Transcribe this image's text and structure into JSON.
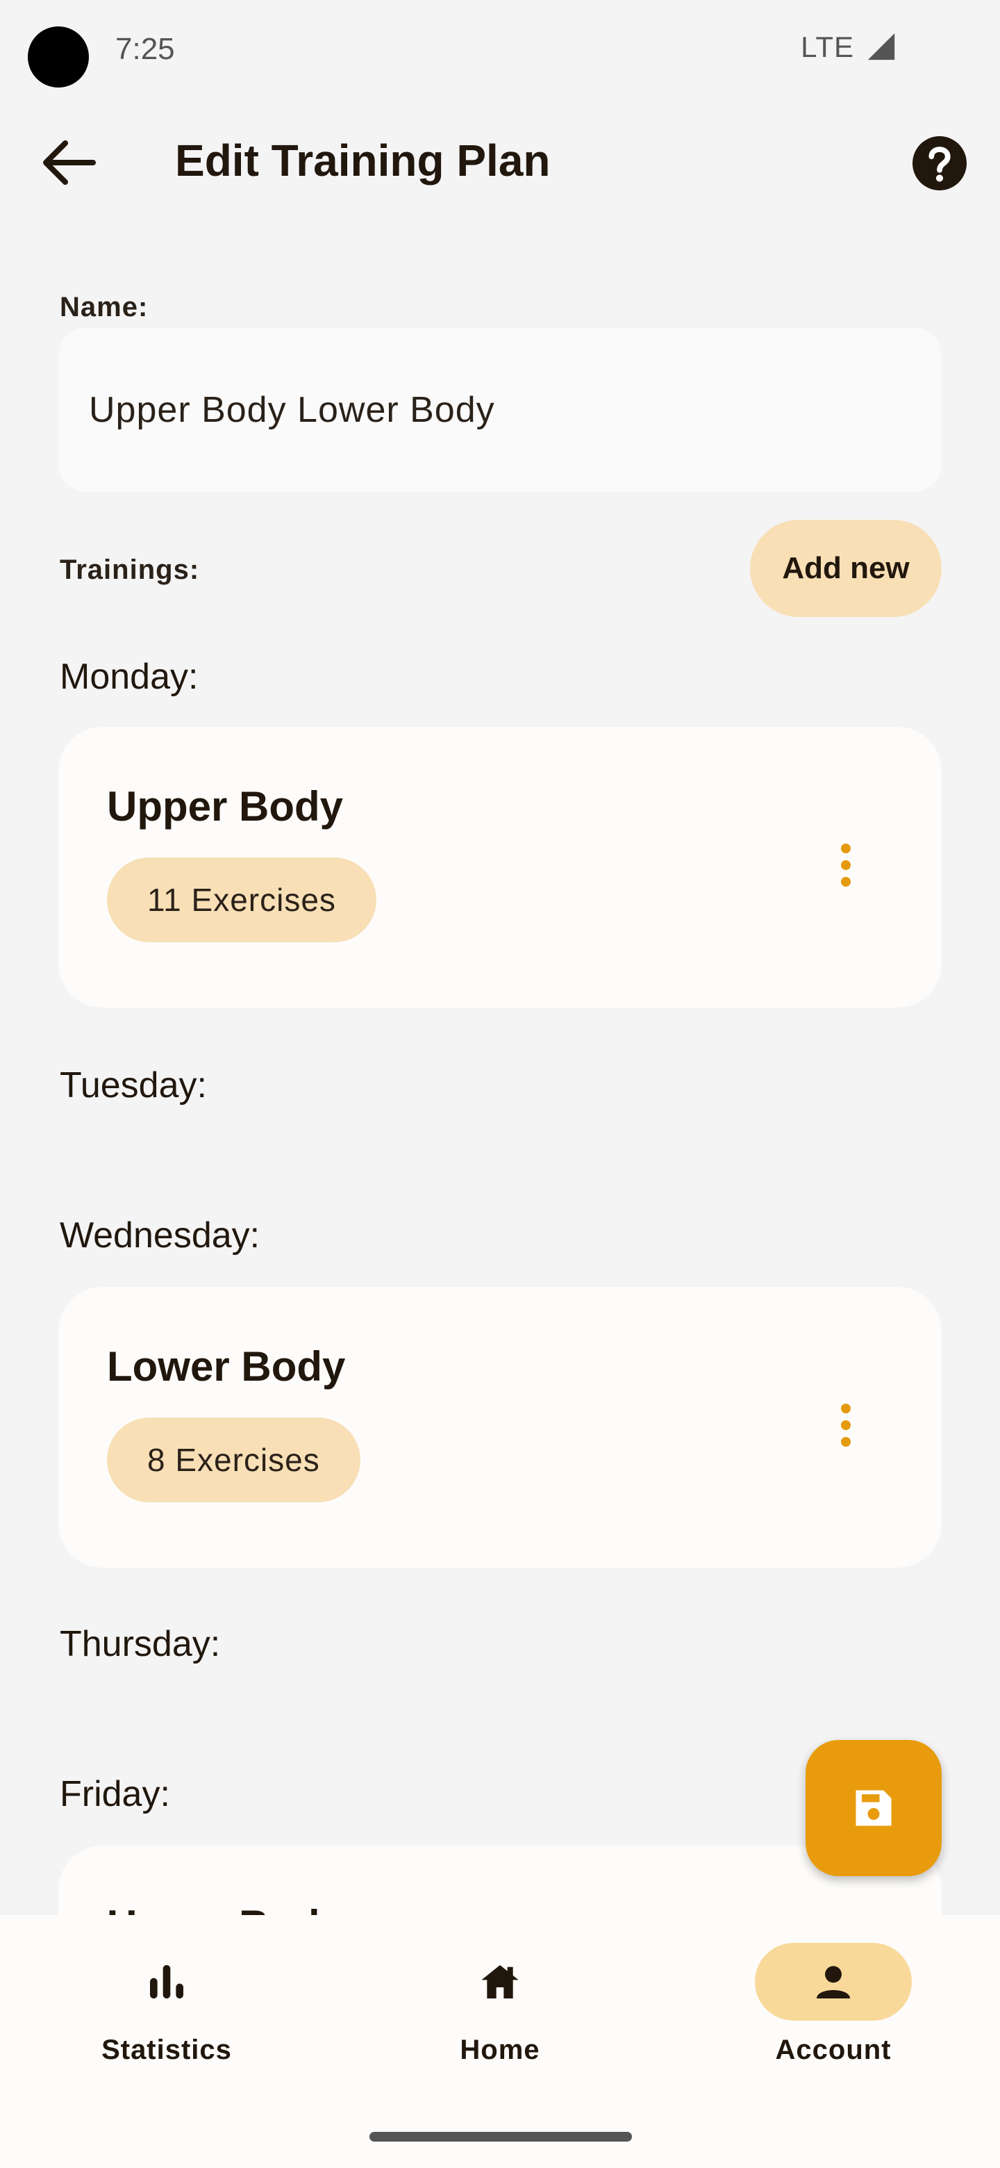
{
  "status_bar": {
    "time": "7:25",
    "network": "LTE"
  },
  "app_bar": {
    "title": "Edit Training Plan"
  },
  "form": {
    "name_label": "Name:",
    "name_value": "Upper Body Lower Body",
    "trainings_label": "Trainings:",
    "add_new_label": "Add new"
  },
  "days": [
    {
      "label": "Monday:",
      "training": {
        "title": "Upper Body",
        "exercises": "11 Exercises"
      }
    },
    {
      "label": "Tuesday:"
    },
    {
      "label": "Wednesday:",
      "training": {
        "title": "Lower Body",
        "exercises": "8 Exercises"
      }
    },
    {
      "label": "Thursday:"
    },
    {
      "label": "Friday:",
      "training": {
        "title": "Upper Body"
      }
    }
  ],
  "bottom_nav": {
    "items": [
      {
        "label": "Statistics",
        "icon": "bar-chart-icon",
        "active": false
      },
      {
        "label": "Home",
        "icon": "home-icon",
        "active": false
      },
      {
        "label": "Account",
        "icon": "person-icon",
        "active": true
      }
    ]
  },
  "colors": {
    "accent": "#e89c0d",
    "chip": "#f8dfb6",
    "nav_active": "#f9d99a",
    "background": "#f4f4f5"
  }
}
